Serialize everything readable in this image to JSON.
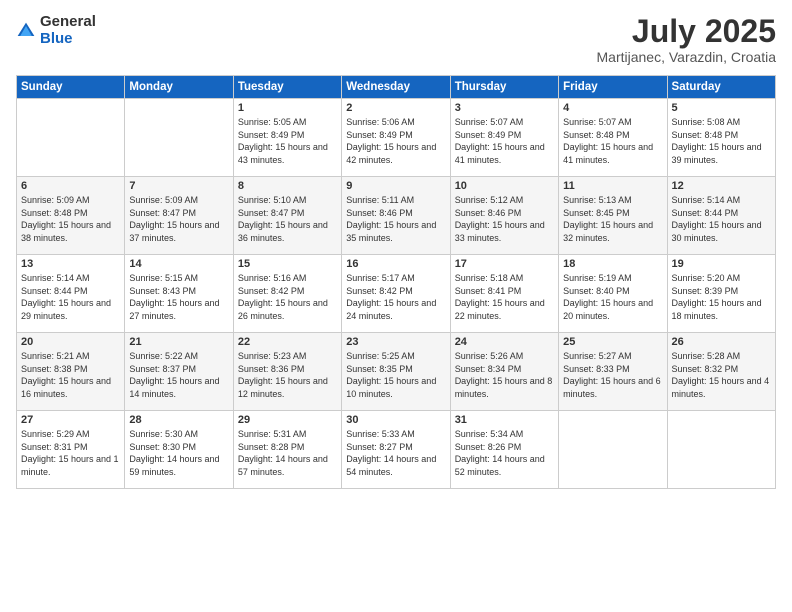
{
  "logo": {
    "general": "General",
    "blue": "Blue"
  },
  "header": {
    "month": "July 2025",
    "location": "Martijanec, Varazdin, Croatia"
  },
  "days": [
    "Sunday",
    "Monday",
    "Tuesday",
    "Wednesday",
    "Thursday",
    "Friday",
    "Saturday"
  ],
  "weeks": [
    [
      {
        "day": "",
        "info": ""
      },
      {
        "day": "",
        "info": ""
      },
      {
        "day": "1",
        "info": "Sunrise: 5:05 AM\nSunset: 8:49 PM\nDaylight: 15 hours and 43 minutes."
      },
      {
        "day": "2",
        "info": "Sunrise: 5:06 AM\nSunset: 8:49 PM\nDaylight: 15 hours and 42 minutes."
      },
      {
        "day": "3",
        "info": "Sunrise: 5:07 AM\nSunset: 8:49 PM\nDaylight: 15 hours and 41 minutes."
      },
      {
        "day": "4",
        "info": "Sunrise: 5:07 AM\nSunset: 8:48 PM\nDaylight: 15 hours and 41 minutes."
      },
      {
        "day": "5",
        "info": "Sunrise: 5:08 AM\nSunset: 8:48 PM\nDaylight: 15 hours and 39 minutes."
      }
    ],
    [
      {
        "day": "6",
        "info": "Sunrise: 5:09 AM\nSunset: 8:48 PM\nDaylight: 15 hours and 38 minutes."
      },
      {
        "day": "7",
        "info": "Sunrise: 5:09 AM\nSunset: 8:47 PM\nDaylight: 15 hours and 37 minutes."
      },
      {
        "day": "8",
        "info": "Sunrise: 5:10 AM\nSunset: 8:47 PM\nDaylight: 15 hours and 36 minutes."
      },
      {
        "day": "9",
        "info": "Sunrise: 5:11 AM\nSunset: 8:46 PM\nDaylight: 15 hours and 35 minutes."
      },
      {
        "day": "10",
        "info": "Sunrise: 5:12 AM\nSunset: 8:46 PM\nDaylight: 15 hours and 33 minutes."
      },
      {
        "day": "11",
        "info": "Sunrise: 5:13 AM\nSunset: 8:45 PM\nDaylight: 15 hours and 32 minutes."
      },
      {
        "day": "12",
        "info": "Sunrise: 5:14 AM\nSunset: 8:44 PM\nDaylight: 15 hours and 30 minutes."
      }
    ],
    [
      {
        "day": "13",
        "info": "Sunrise: 5:14 AM\nSunset: 8:44 PM\nDaylight: 15 hours and 29 minutes."
      },
      {
        "day": "14",
        "info": "Sunrise: 5:15 AM\nSunset: 8:43 PM\nDaylight: 15 hours and 27 minutes."
      },
      {
        "day": "15",
        "info": "Sunrise: 5:16 AM\nSunset: 8:42 PM\nDaylight: 15 hours and 26 minutes."
      },
      {
        "day": "16",
        "info": "Sunrise: 5:17 AM\nSunset: 8:42 PM\nDaylight: 15 hours and 24 minutes."
      },
      {
        "day": "17",
        "info": "Sunrise: 5:18 AM\nSunset: 8:41 PM\nDaylight: 15 hours and 22 minutes."
      },
      {
        "day": "18",
        "info": "Sunrise: 5:19 AM\nSunset: 8:40 PM\nDaylight: 15 hours and 20 minutes."
      },
      {
        "day": "19",
        "info": "Sunrise: 5:20 AM\nSunset: 8:39 PM\nDaylight: 15 hours and 18 minutes."
      }
    ],
    [
      {
        "day": "20",
        "info": "Sunrise: 5:21 AM\nSunset: 8:38 PM\nDaylight: 15 hours and 16 minutes."
      },
      {
        "day": "21",
        "info": "Sunrise: 5:22 AM\nSunset: 8:37 PM\nDaylight: 15 hours and 14 minutes."
      },
      {
        "day": "22",
        "info": "Sunrise: 5:23 AM\nSunset: 8:36 PM\nDaylight: 15 hours and 12 minutes."
      },
      {
        "day": "23",
        "info": "Sunrise: 5:25 AM\nSunset: 8:35 PM\nDaylight: 15 hours and 10 minutes."
      },
      {
        "day": "24",
        "info": "Sunrise: 5:26 AM\nSunset: 8:34 PM\nDaylight: 15 hours and 8 minutes."
      },
      {
        "day": "25",
        "info": "Sunrise: 5:27 AM\nSunset: 8:33 PM\nDaylight: 15 hours and 6 minutes."
      },
      {
        "day": "26",
        "info": "Sunrise: 5:28 AM\nSunset: 8:32 PM\nDaylight: 15 hours and 4 minutes."
      }
    ],
    [
      {
        "day": "27",
        "info": "Sunrise: 5:29 AM\nSunset: 8:31 PM\nDaylight: 15 hours and 1 minute."
      },
      {
        "day": "28",
        "info": "Sunrise: 5:30 AM\nSunset: 8:30 PM\nDaylight: 14 hours and 59 minutes."
      },
      {
        "day": "29",
        "info": "Sunrise: 5:31 AM\nSunset: 8:28 PM\nDaylight: 14 hours and 57 minutes."
      },
      {
        "day": "30",
        "info": "Sunrise: 5:33 AM\nSunset: 8:27 PM\nDaylight: 14 hours and 54 minutes."
      },
      {
        "day": "31",
        "info": "Sunrise: 5:34 AM\nSunset: 8:26 PM\nDaylight: 14 hours and 52 minutes."
      },
      {
        "day": "",
        "info": ""
      },
      {
        "day": "",
        "info": ""
      }
    ]
  ]
}
